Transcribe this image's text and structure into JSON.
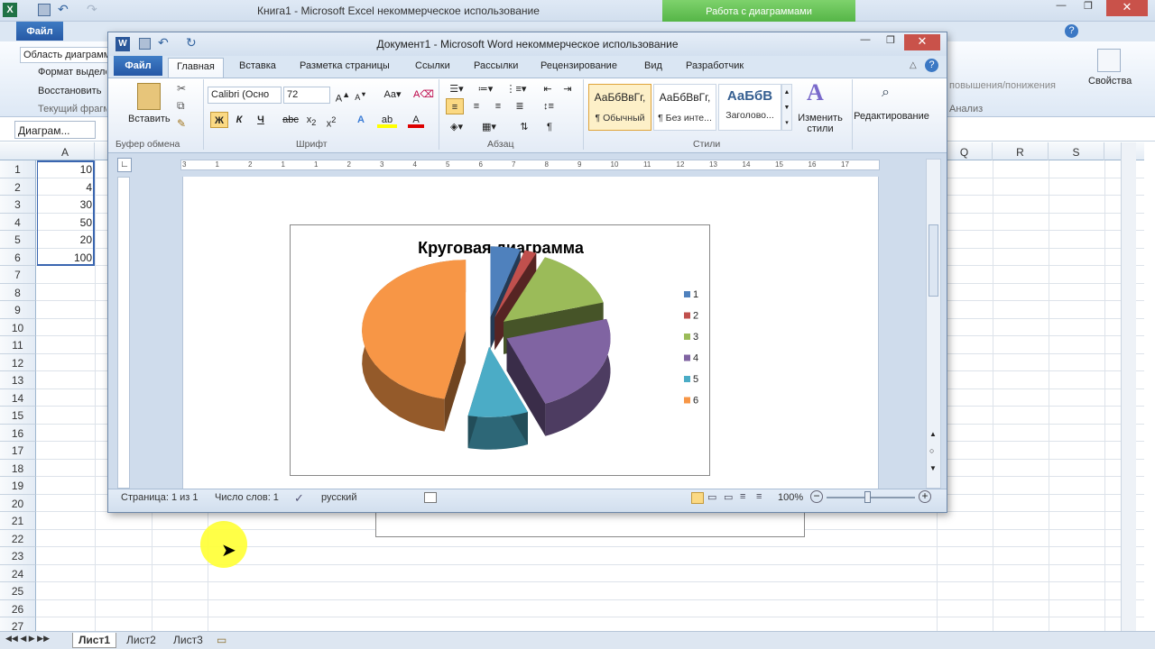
{
  "excel": {
    "window_title": "Книга1 - Microsoft Excel некоммерческое использование",
    "context_tab": "Работа с диаграммами",
    "file_tab": "Файл",
    "ribbon_left": {
      "items": [
        "Область диаграммы",
        "Формат выделенного",
        "Восстановить"
      ],
      "group": "Текущий фрагмент"
    },
    "ribbon_right": {
      "updown": "повышения/понижения",
      "analysis": "Анализ",
      "properties": "Свойства"
    },
    "namebox": "Диаграм...",
    "columns_left": [
      "A"
    ],
    "columns_right": [
      "Q",
      "R",
      "S"
    ],
    "rows": [
      "1",
      "2",
      "3",
      "4",
      "5",
      "6",
      "7",
      "8",
      "9",
      "10",
      "11",
      "12",
      "13",
      "14",
      "15",
      "16",
      "17",
      "18",
      "19",
      "20",
      "21",
      "22",
      "23",
      "24",
      "25",
      "26",
      "27"
    ],
    "values": [
      "10",
      "4",
      "30",
      "50",
      "20",
      "100"
    ],
    "sheets": [
      "Лист1",
      "Лист2",
      "Лист3"
    ]
  },
  "word": {
    "window_title": "Документ1 - Microsoft Word некоммерческое использование",
    "file_tab": "Файл",
    "tabs": [
      "Главная",
      "Вставка",
      "Разметка страницы",
      "Ссылки",
      "Рассылки",
      "Рецензирование",
      "Вид",
      "Разработчик"
    ],
    "clipboard": {
      "paste": "Вставить",
      "group": "Буфер обмена"
    },
    "font": {
      "name": "Calibri (Осно",
      "size": "72",
      "group": "Шрифт",
      "bold": "Ж",
      "italic": "К",
      "underline": "Ч"
    },
    "paragraph": {
      "group": "Абзац"
    },
    "styles": {
      "group": "Стили",
      "items": [
        {
          "sample": "АаБбВвГг,",
          "name": "¶ Обычный"
        },
        {
          "sample": "АаБбВвГг,",
          "name": "¶ Без инте..."
        },
        {
          "sample": "АаБбВ",
          "name": "Заголово..."
        }
      ],
      "change": "Изменить стили"
    },
    "editing": "Редактирование",
    "ruler_marks": [
      "3",
      "1",
      "2",
      "1",
      "1",
      "2",
      "3",
      "4",
      "5",
      "6",
      "7",
      "8",
      "9",
      "10",
      "11",
      "12",
      "13",
      "14",
      "15",
      "16",
      "17"
    ],
    "status": {
      "page": "Страница: 1 из 1",
      "words": "Число слов: 1",
      "language": "русский",
      "zoom": "100%"
    }
  },
  "chart_data": {
    "type": "pie",
    "title": "Круговая диаграмма",
    "categories": [
      "1",
      "2",
      "3",
      "4",
      "5",
      "6"
    ],
    "values": [
      10,
      4,
      30,
      50,
      20,
      100
    ],
    "colors": [
      "#4f81bd",
      "#c0504d",
      "#9bbb59",
      "#8064a2",
      "#4bacc6",
      "#f79646"
    ],
    "legend": "right",
    "style": "3d-exploded"
  }
}
